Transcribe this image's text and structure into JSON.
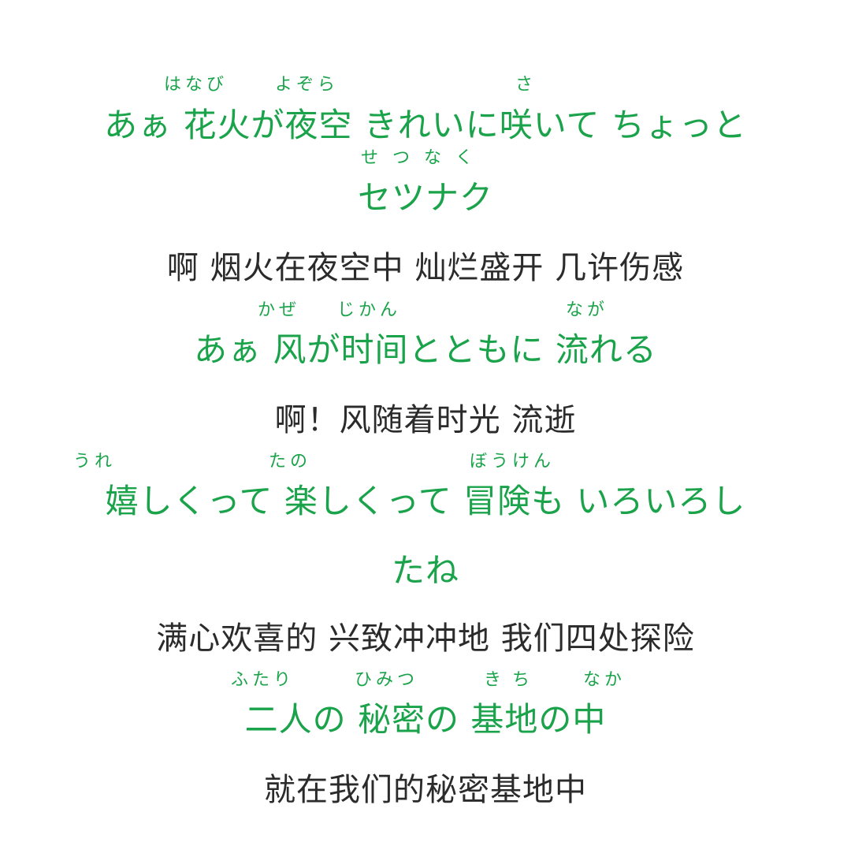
{
  "lyrics": [
    {
      "type": "jp",
      "text": "あぁ 花火が夜空 きれいに咲いて ちょっと",
      "ruby": [
        "はなび",
        "よぞら",
        "さ"
      ]
    },
    {
      "type": "jp",
      "text": "セツナク",
      "ruby": [
        "せつなく"
      ]
    },
    {
      "type": "cn",
      "text": "啊 烟火在夜空中 灿烂盛开 几许伤感"
    },
    {
      "type": "jp",
      "text": "あぁ 风が时间とともに 流れる",
      "ruby": [
        "かぜ",
        "じかん",
        "なが"
      ]
    },
    {
      "type": "cn",
      "text": "啊！风随着时光 流逝"
    },
    {
      "type": "jp",
      "text": "嬉しくって 楽しくって 冒険も いろいろし",
      "ruby": [
        "うれ",
        "たの",
        "ぼうけん"
      ]
    },
    {
      "type": "jp",
      "text": "たね"
    },
    {
      "type": "cn",
      "text": "满心欢喜的 兴致冲冲地 我们四处探险"
    },
    {
      "type": "jp",
      "text": "二人の 秘密の 基地の中",
      "ruby": [
        "ふたり",
        "ひみつ",
        "きち",
        "なか"
      ]
    },
    {
      "type": "cn",
      "text": "就在我们的秘密基地中"
    }
  ],
  "colors": {
    "japanese": "#1aa34a",
    "chinese": "#2b2b2b",
    "background": "#ffffff"
  }
}
